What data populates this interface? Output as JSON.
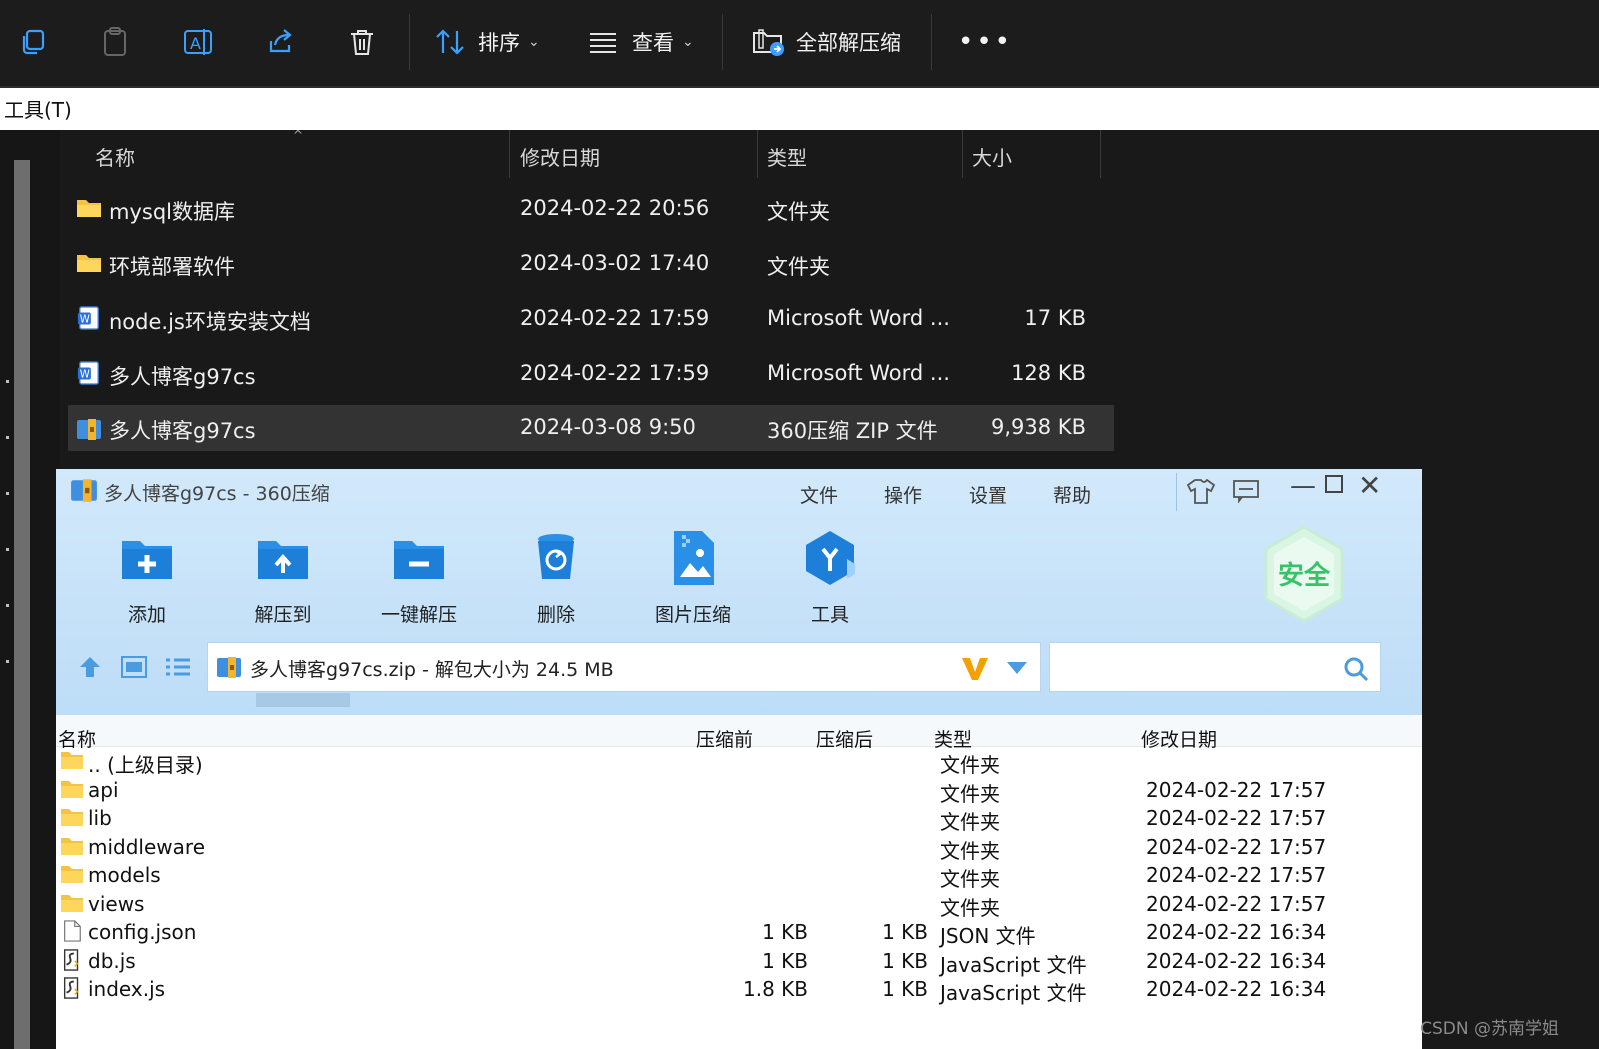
{
  "toolbar": {
    "sort_label": "排序",
    "view_label": "查看",
    "extract_all_label": "全部解压缩"
  },
  "menubar": {
    "tools_label": "工具(T)"
  },
  "explorer": {
    "columns": [
      "名称",
      "修改日期",
      "类型",
      "大小"
    ],
    "rows": [
      {
        "name": "mysql数据库",
        "date": "2024-02-22 20:56",
        "type": "文件夹",
        "size": "",
        "icon": "folder-icon"
      },
      {
        "name": "环境部署软件",
        "date": "2024-03-02 17:40",
        "type": "文件夹",
        "size": "",
        "icon": "folder-icon"
      },
      {
        "name": "node.js环境安装文档",
        "date": "2024-02-22 17:59",
        "type": "Microsoft Word ...",
        "size": "17 KB",
        "icon": "word-doc-icon"
      },
      {
        "name": "多人博客g97cs",
        "date": "2024-02-22 17:59",
        "type": "Microsoft Word ...",
        "size": "128 KB",
        "icon": "word-doc-icon"
      },
      {
        "name": "多人博客g97cs",
        "date": "2024-03-08 9:50",
        "type": "360压缩 ZIP 文件",
        "size": "9,938 KB",
        "icon": "zip-archive-icon",
        "selected": true
      }
    ]
  },
  "zip": {
    "title": "多人博客g97cs - 360压缩",
    "menu": [
      "文件",
      "操作",
      "设置",
      "帮助"
    ],
    "tools": [
      "添加",
      "解压到",
      "一键解压",
      "删除",
      "图片压缩",
      "工具"
    ],
    "badge": "安全",
    "path_text": "多人博客g97cs.zip - 解包大小为 24.5 MB",
    "columns": [
      "名称",
      "压缩前",
      "压缩后",
      "类型",
      "修改日期"
    ],
    "rows": [
      {
        "name": ".. (上级目录)",
        "before": "",
        "after": "",
        "type": "文件夹",
        "date": "",
        "icon": "folder-icon"
      },
      {
        "name": "api",
        "before": "",
        "after": "",
        "type": "文件夹",
        "date": "2024-02-22 17:57",
        "icon": "folder-icon"
      },
      {
        "name": "lib",
        "before": "",
        "after": "",
        "type": "文件夹",
        "date": "2024-02-22 17:57",
        "icon": "folder-icon"
      },
      {
        "name": "middleware",
        "before": "",
        "after": "",
        "type": "文件夹",
        "date": "2024-02-22 17:57",
        "icon": "folder-icon"
      },
      {
        "name": "models",
        "before": "",
        "after": "",
        "type": "文件夹",
        "date": "2024-02-22 17:57",
        "icon": "folder-icon"
      },
      {
        "name": "views",
        "before": "",
        "after": "",
        "type": "文件夹",
        "date": "2024-02-22 17:57",
        "icon": "folder-icon"
      },
      {
        "name": "config.json",
        "before": "1 KB",
        "after": "1 KB",
        "type": "JSON 文件",
        "date": "2024-02-22 16:34",
        "icon": "file-icon"
      },
      {
        "name": "db.js",
        "before": "1 KB",
        "after": "1 KB",
        "type": "JavaScript 文件",
        "date": "2024-02-22 16:34",
        "icon": "script-file-icon"
      },
      {
        "name": "index.js",
        "before": "1.8 KB",
        "after": "1 KB",
        "type": "JavaScript 文件",
        "date": "2024-02-22 16:34",
        "icon": "script-file-icon"
      }
    ]
  },
  "watermark": "CSDN @苏南学姐",
  "colors": {
    "folder": "#f5c343",
    "accent_blue": "#1e8fe8",
    "zip_header": "#c9e4fa",
    "selected_row": "#333333"
  }
}
